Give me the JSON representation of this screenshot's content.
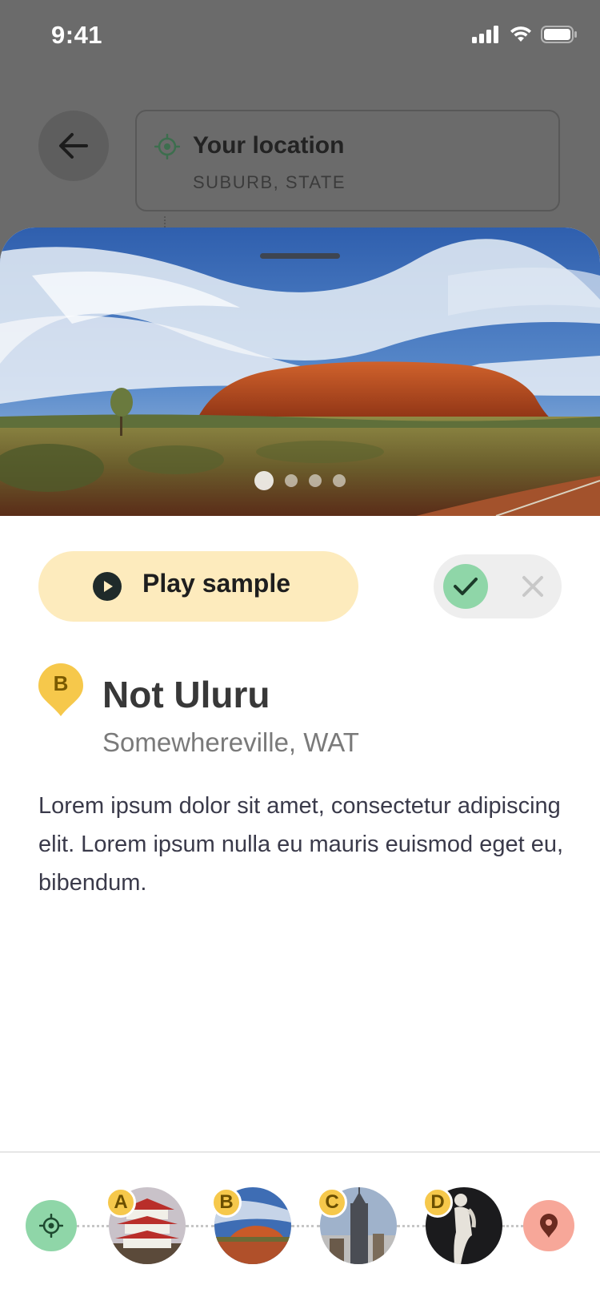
{
  "status_bar": {
    "time": "9:41"
  },
  "header": {
    "location_title": "Your location",
    "location_subtitle": "SUBURB, STATE"
  },
  "hero": {
    "slide_count": 4,
    "active_slide": 1
  },
  "actions": {
    "play_label": "Play sample",
    "accept_icon": "check-icon",
    "reject_icon": "close-icon"
  },
  "place": {
    "marker": "B",
    "name": "Not Uluru",
    "location": "Somewhereville, WAT",
    "description": "Lorem ipsum dolor sit amet, consectetur adipiscing elit. Lorem ipsum nulla eu mauris euismod eget eu, bibendum."
  },
  "route": {
    "start_icon": "crosshair-icon",
    "end_icon": "map-pin-icon",
    "stops": [
      {
        "letter": "A"
      },
      {
        "letter": "B"
      },
      {
        "letter": "C"
      },
      {
        "letter": "D"
      }
    ]
  },
  "colors": {
    "accent_yellow": "#f6c84b",
    "play_bg": "#fdebbd",
    "accept_green": "#8fd6a8",
    "end_red": "#f7a799"
  }
}
